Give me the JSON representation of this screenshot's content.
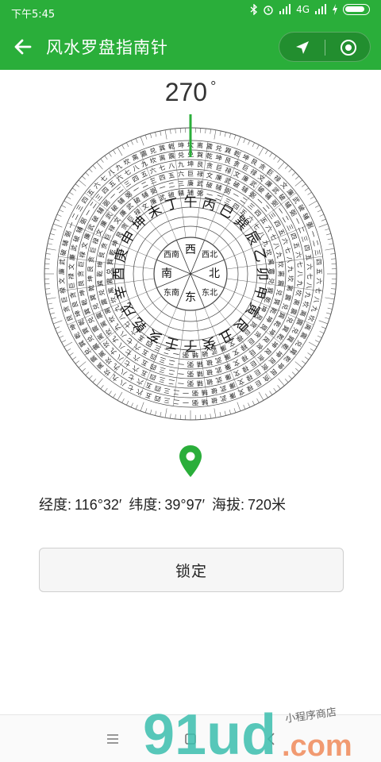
{
  "status_bar": {
    "time": "下午5:45",
    "network": "4G",
    "icons": [
      "bluetooth-icon",
      "alarm-icon",
      "signal-icon",
      "wifi-icon",
      "charging-icon",
      "battery-icon"
    ]
  },
  "header": {
    "title": "风水罗盘指南针",
    "back_icon": "back-arrow-icon",
    "capsule_icons": [
      "navigation-arrow-icon",
      "target-icon"
    ]
  },
  "compass": {
    "degree_value": "270",
    "degree_symbol": "°",
    "inner_directions": [
      "东",
      "南",
      "西",
      "北",
      "东南",
      "西南",
      "西北",
      "东北"
    ],
    "mountains": [
      "子",
      "癸",
      "丑",
      "艮",
      "寅",
      "甲",
      "卯",
      "乙",
      "辰",
      "巽",
      "巳",
      "丙",
      "午",
      "丁",
      "未",
      "坤",
      "申",
      "庚",
      "酉",
      "辛",
      "戌",
      "乾",
      "亥",
      "壬"
    ],
    "ring_chars": [
      "坎",
      "离",
      "震",
      "兑",
      "巽",
      "乾",
      "坤",
      "艮",
      "贪",
      "巨",
      "禄",
      "文",
      "廉",
      "武",
      "破",
      "辅",
      "弼",
      "一",
      "二",
      "三",
      "四",
      "五",
      "六",
      "七",
      "八",
      "九"
    ],
    "accent_color": "#2aae3a"
  },
  "location": {
    "pin_icon": "location-pin-icon",
    "longitude_label": "经度:",
    "longitude_value": "116°32′",
    "latitude_label": "纬度:",
    "latitude_value": "39°97′",
    "altitude_label": "海拔:",
    "altitude_value": "720米"
  },
  "actions": {
    "lock_label": "锁定"
  },
  "nav": {
    "icons": [
      "menu-icon",
      "home-icon",
      "back-icon"
    ]
  },
  "watermark": {
    "brand": "91ud",
    "domain": ".com",
    "tagline": "小程序商店"
  }
}
